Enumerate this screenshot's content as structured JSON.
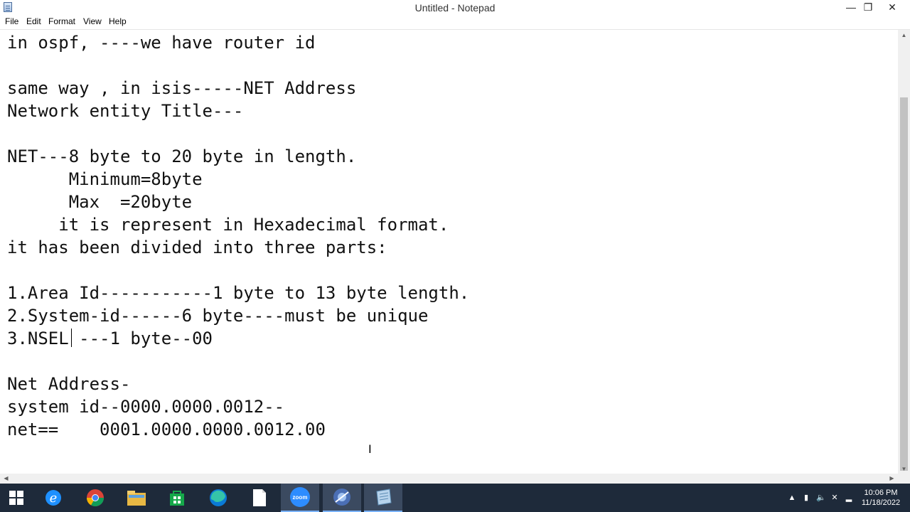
{
  "window": {
    "title": "Untitled - Notepad",
    "min_glyph": "—",
    "max_glyph": "❐",
    "close_glyph": "✕"
  },
  "menu": [
    "File",
    "Edit",
    "Format",
    "View",
    "Help"
  ],
  "editor": {
    "lines": [
      "in ospf, ----we have router id",
      "",
      "same way , in isis-----NET Address",
      "Network entity Title---",
      "",
      "NET---8 byte to 20 byte in length.",
      "      Minimum=8byte",
      "      Max  =20byte",
      "     it is represent in Hexadecimal format.",
      "it has been divided into three parts:",
      "",
      "1.Area Id-----------1 byte to 13 byte length.",
      "2.System-id------6 byte----must be unique",
      "3.NSEL ---1 byte--00",
      "",
      "Net Address-",
      "system id--0000.0000.0012--",
      "net==    0001.0000.0000.0012.00"
    ]
  },
  "taskbar": {
    "apps": [
      "start-icon",
      "edge-legacy-icon",
      "chrome-icon",
      "file-explorer-icon",
      "store-icon",
      "edge-icon",
      "blank-file-icon",
      "zoom-icon",
      "browser-app-icon",
      "notepad-icon"
    ],
    "zoom_label": "zoom",
    "clock_time": "10:06 PM",
    "clock_date": "11/18/2022"
  },
  "colors": {
    "taskbar": "#1e2a3a",
    "accent": "#0078d7",
    "text": "#111111"
  }
}
